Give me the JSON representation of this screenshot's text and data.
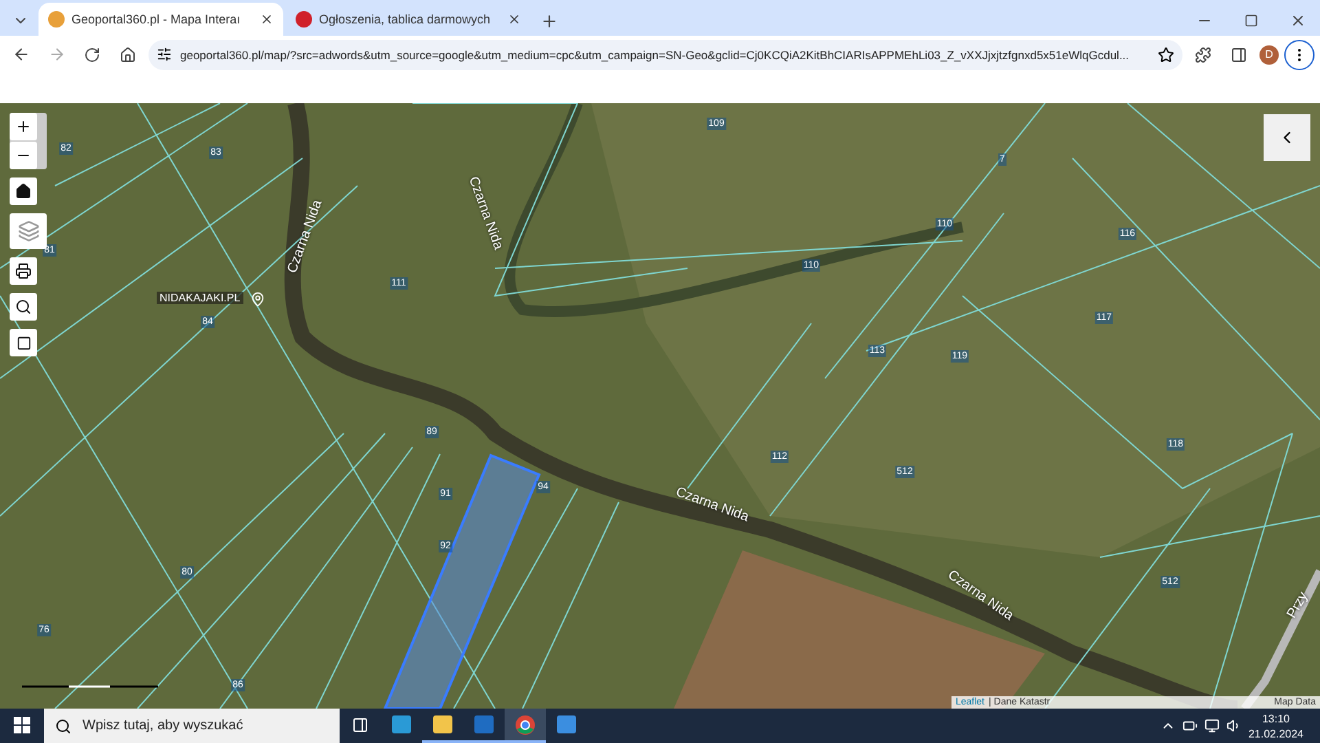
{
  "browser": {
    "tabs": [
      {
        "title": "Geoportal360.pl - Mapa Interaı",
        "selected": true
      },
      {
        "title": "Ogłoszenia, tablica darmowych",
        "selected": false
      }
    ],
    "url": "geoportal360.pl/map/?src=adwords&utm_source=google&utm_medium=cpc&utm_campaign=SN-Geo&gclid=Cj0KCQiA2KitBhCIARIsAPPMEhLi03_Z_vXXJjxjtzfgnxd5x51eWlqGcdul...",
    "profile_initial": "D"
  },
  "map": {
    "parcel_labels": [
      "82",
      "83",
      "81",
      "84",
      "111",
      "109",
      "7",
      "110",
      "110",
      "116",
      "117",
      "113",
      "119",
      "118",
      "89",
      "91",
      "94",
      "112",
      "512",
      "92",
      "80",
      "512",
      "76",
      "86"
    ],
    "place_label": "NIDAKAJAKI.PL",
    "river_labels": [
      "Czarna Nida",
      "Czarna Nida",
      "Czarna Nida",
      "Czarna Nida"
    ],
    "road_label": "Przy",
    "attribution": {
      "link": "Leaflet",
      "text": "| Dane Katastr",
      "text_2": "Map Data"
    }
  },
  "taskbar": {
    "search_placeholder": "Wpisz tutaj, aby wyszukać",
    "time": "13:10",
    "date": "21.02.2024"
  }
}
